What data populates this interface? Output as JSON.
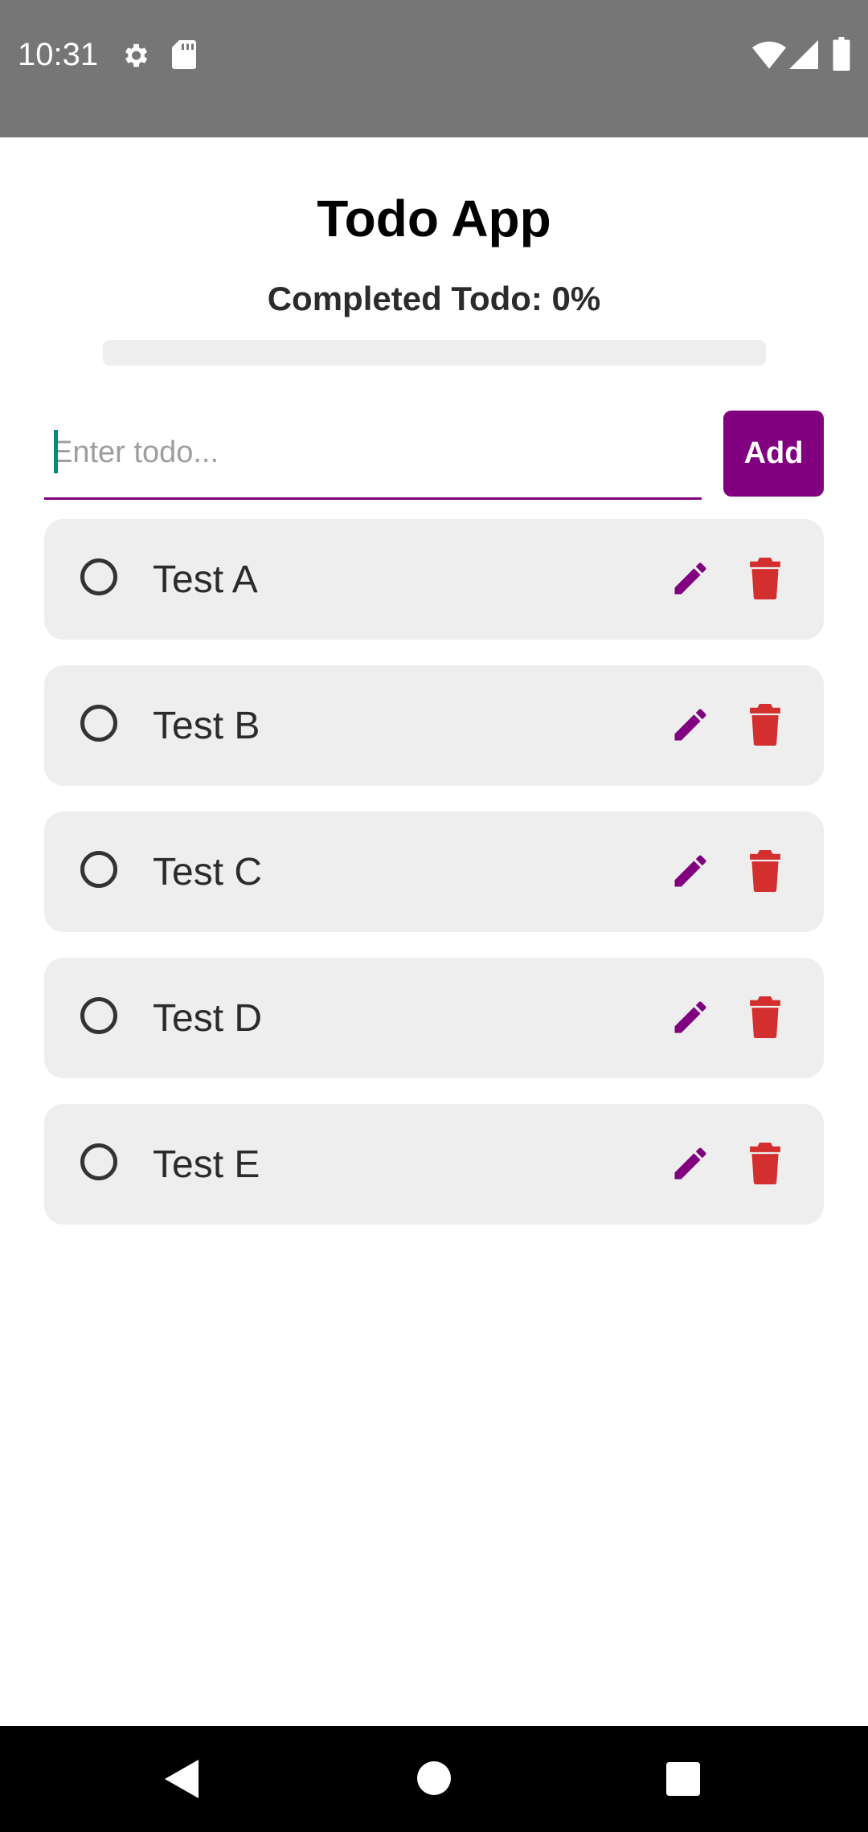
{
  "status_bar": {
    "time": "10:31",
    "icons": [
      "settings-icon",
      "sd-card-icon",
      "wifi-icon",
      "signal-icon",
      "battery-icon"
    ]
  },
  "app": {
    "title": "Todo App",
    "progress_label": "Completed Todo: 0%",
    "progress_fraction": 0
  },
  "input": {
    "placeholder": "Enter todo...",
    "value": ""
  },
  "add_button": {
    "label": "Add"
  },
  "todos": [
    {
      "text": "Test A",
      "completed": false
    },
    {
      "text": "Test B",
      "completed": false
    },
    {
      "text": "Test C",
      "completed": false
    },
    {
      "text": "Test D",
      "completed": false
    },
    {
      "text": "Test E",
      "completed": false
    }
  ],
  "colors": {
    "accent": "#800080",
    "delete": "#d32f2f",
    "status_bar": "#767676",
    "item_bg": "#eeeeee"
  },
  "nav_bar": {
    "icons": [
      "back-icon",
      "home-icon",
      "recents-icon"
    ]
  }
}
